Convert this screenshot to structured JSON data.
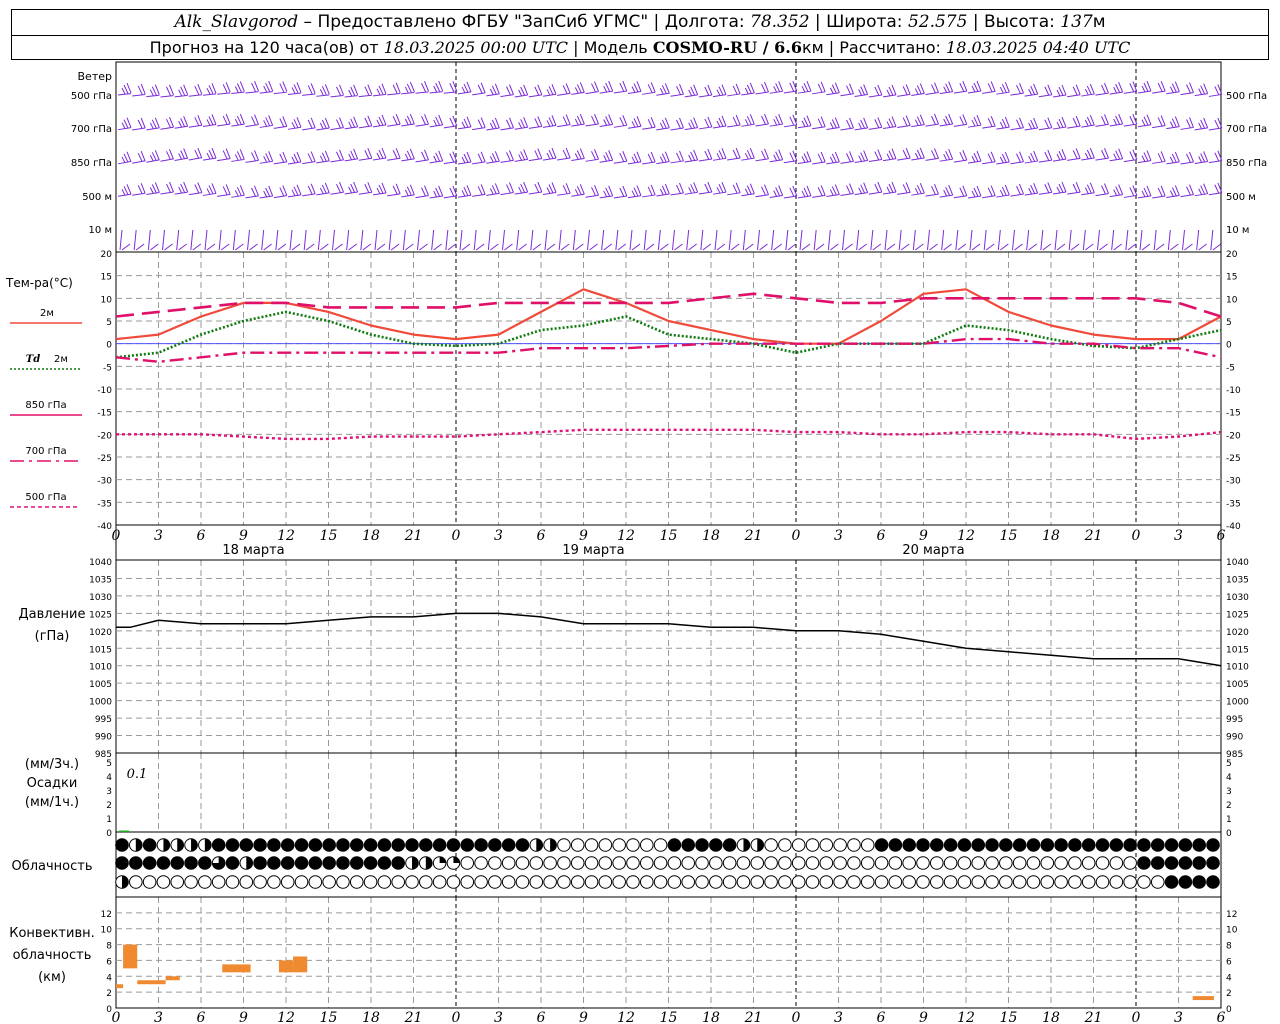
{
  "header": {
    "station": "Alk_Slavgorod",
    "dash": " – ",
    "provider": "Предоставлено ФГБУ \"ЗапСиб УГМС\"",
    "sep": " | ",
    "lon_label": "Долгота:",
    "lon_value": "78.352",
    "lat_label": "Широта:",
    "lat_value": "52.575",
    "alt_label": "Высота:",
    "alt_value": "137",
    "alt_unit": "м",
    "forecast_text": "Прогноз на 120 часа(ов) от",
    "forecast_start": "18.03.2025 00:00 UTC",
    "model_label": "Модель",
    "model_name": "COSMO-RU / 6.6",
    "model_unit": "км",
    "calc_label": "Рассчитано:",
    "calc_time": "18.03.2025 04:40 UTC"
  },
  "labels": {
    "wind_title": "Ветер",
    "wind_levels": [
      "500 гПа",
      "700 гПа",
      "850 гПа",
      "500 м",
      "10 м"
    ],
    "temp_title": "Тем-ра(°С)",
    "legend_2m": "2м",
    "legend_td": "Td",
    "legend_td_unit": "2м",
    "legend_850": "850 гПа",
    "legend_700": "700 гПа",
    "legend_500": "500 гПа",
    "pressure_title_1": "Давление",
    "pressure_title_2": "(гПа)",
    "precip_label_1": "(мм/3ч.)",
    "precip_label_2": "Осадки",
    "precip_label_3": "(мм/1ч.)",
    "precip_note": "0.1",
    "cloud_title": "Облачность",
    "conv_title_1": "Конвективн.",
    "conv_title_2": "облачность",
    "conv_title_3": "(км)",
    "days": [
      "18 марта",
      "19 марта",
      "20 марта"
    ]
  },
  "colors": {
    "wind": "#7b2ad8",
    "t2m": "#f04a3a",
    "td2m": "#107a10",
    "t850": "#e0106a",
    "t700": "#e0106a",
    "t500": "#e0107a",
    "pressure": "#000000",
    "precip": "#22aa22",
    "conv": "#f08a30",
    "zero_line": "#5555ff",
    "grid": "#9a9a9a"
  },
  "icons": {
    "cloud_cover": "cloud-cover-circle-icon"
  },
  "chart_data": [
    {
      "type": "wind-barbs",
      "levels": [
        "500 гПа",
        "700 гПа",
        "850 гПа",
        "500 м",
        "10 м"
      ],
      "x_hours": [
        0,
        120
      ],
      "x_tick_labels": [
        "0",
        "3",
        "6",
        "9",
        "12",
        "15",
        "18",
        "21",
        "0",
        "3",
        "6",
        "9",
        "12",
        "15",
        "18",
        "21",
        "0",
        "3",
        "6",
        "9",
        "12",
        "15",
        "18",
        "21",
        "0",
        "3",
        "6"
      ]
    },
    {
      "type": "line",
      "title": "Тем-ра(°С)",
      "x_unit": "hours",
      "x_tick_labels": [
        "0",
        "3",
        "6",
        "9",
        "12",
        "15",
        "18",
        "21",
        "0",
        "3",
        "6",
        "9",
        "12",
        "15",
        "18",
        "21",
        "0",
        "3",
        "6",
        "9",
        "12",
        "15",
        "18",
        "21",
        "0",
        "3",
        "6"
      ],
      "day_labels": [
        "18 марта",
        "19 марта",
        "20 марта"
      ],
      "ylim": [
        -40,
        20
      ],
      "yticks": [
        20,
        15,
        10,
        5,
        0,
        -5,
        -10,
        -15,
        -20,
        -25,
        -30,
        -35,
        -40
      ],
      "grid": true,
      "series": [
        {
          "name": "2м",
          "style": "solid",
          "x": [
            0,
            3,
            6,
            9,
            12,
            15,
            18,
            21,
            24,
            27,
            30,
            33,
            36,
            39,
            42,
            45,
            48,
            51,
            54,
            57,
            60,
            63,
            66,
            69,
            72,
            75,
            78
          ],
          "y": [
            1,
            2,
            6,
            9,
            9,
            7,
            4,
            2,
            1,
            2,
            7,
            12,
            9,
            5,
            3,
            1,
            0,
            0,
            5,
            11,
            12,
            7,
            4,
            2,
            1,
            1,
            6
          ]
        },
        {
          "name": "Td 2м",
          "style": "dotted",
          "x": [
            0,
            3,
            6,
            9,
            12,
            15,
            18,
            21,
            24,
            27,
            30,
            33,
            36,
            39,
            42,
            45,
            48,
            51,
            54,
            57,
            60,
            63,
            66,
            69,
            72,
            75,
            78
          ],
          "y": [
            -3,
            -2,
            2,
            5,
            7,
            5,
            2,
            0,
            -0.5,
            0,
            3,
            4,
            6,
            2,
            1,
            0,
            -2,
            0,
            0,
            0,
            4,
            3,
            1,
            -0.5,
            -1,
            1,
            3
          ]
        },
        {
          "name": "850 гПа",
          "style": "long-dash",
          "x": [
            0,
            3,
            6,
            9,
            12,
            15,
            18,
            21,
            24,
            27,
            30,
            33,
            36,
            39,
            42,
            45,
            48,
            51,
            54,
            57,
            60,
            63,
            66,
            69,
            72,
            75,
            78
          ],
          "y": [
            6,
            7,
            8,
            9,
            9,
            8,
            8,
            8,
            8,
            9,
            9,
            9,
            9,
            9,
            10,
            11,
            10,
            9,
            9,
            10,
            10,
            10,
            10,
            10,
            10,
            9,
            6
          ]
        },
        {
          "name": "700 гПа",
          "style": "dash-dot",
          "x": [
            0,
            3,
            6,
            9,
            12,
            15,
            18,
            21,
            24,
            27,
            30,
            33,
            36,
            39,
            42,
            45,
            48,
            51,
            54,
            57,
            60,
            63,
            66,
            69,
            72,
            75,
            78
          ],
          "y": [
            -3,
            -4,
            -3,
            -2,
            -2,
            -2,
            -2,
            -2,
            -2,
            -2,
            -1,
            -1,
            -1,
            -0.5,
            0,
            0,
            0,
            0,
            0,
            0,
            1,
            1,
            0,
            0,
            -1,
            -1,
            -3
          ]
        },
        {
          "name": "500 гПа",
          "style": "short-dash",
          "x": [
            0,
            3,
            6,
            9,
            12,
            15,
            18,
            21,
            24,
            27,
            30,
            33,
            36,
            39,
            42,
            45,
            48,
            51,
            54,
            57,
            60,
            63,
            66,
            69,
            72,
            75,
            78
          ],
          "y": [
            -20,
            -20,
            -20,
            -20.5,
            -21,
            -21,
            -20.5,
            -20.5,
            -20.5,
            -20,
            -19.5,
            -19,
            -19,
            -19,
            -19,
            -19,
            -19.5,
            -19.5,
            -20,
            -20,
            -19.5,
            -19.5,
            -20,
            -20,
            -21,
            -20.5,
            -19.5
          ]
        }
      ]
    },
    {
      "type": "line",
      "title": "Давление (гПа)",
      "ylim": [
        985,
        1040
      ],
      "yticks": [
        1040,
        1035,
        1030,
        1025,
        1020,
        1015,
        1010,
        1005,
        1000,
        995,
        990,
        985
      ],
      "grid": true,
      "series": [
        {
          "name": "Давление",
          "x": [
            0,
            1,
            3,
            6,
            9,
            12,
            15,
            18,
            21,
            24,
            27,
            30,
            33,
            36,
            39,
            42,
            45,
            48,
            51,
            54,
            57,
            60,
            63,
            66,
            69,
            72,
            75,
            78
          ],
          "y": [
            1021,
            1021,
            1023,
            1022,
            1022,
            1022,
            1023,
            1024,
            1024,
            1025,
            1025,
            1024,
            1022,
            1022,
            1022,
            1021,
            1021,
            1020,
            1020,
            1019,
            1017,
            1015,
            1014,
            1013,
            1012,
            1012,
            1012,
            1010
          ]
        }
      ]
    },
    {
      "type": "bar",
      "title": "Осадки",
      "ylim": [
        0,
        5
      ],
      "yticks": [
        5,
        4,
        3,
        2,
        1,
        0
      ],
      "annotations": [
        "0.1"
      ],
      "bars": [
        {
          "x": 0.5,
          "value": 0.1
        }
      ]
    },
    {
      "type": "table",
      "title": "Облачность",
      "rows": 3,
      "cells_per_row": 80,
      "cover": [
        "84844448888888888888888888888844000000008888844000000008888888888888888888888888",
        "88888886848888888888844220000000000000000000000000000000000000000000000000888888",
        "40000000000000000000000000000000000000000000000000000000000000000000000000008888"
      ]
    },
    {
      "type": "bar",
      "title": "Конвективн. облачность (км)",
      "ylim": [
        0,
        14
      ],
      "yticks": [
        12,
        10,
        8,
        6,
        4,
        2,
        0
      ],
      "bars": [
        {
          "x0": 0,
          "x1": 0.5,
          "lo": 2.5,
          "hi": 3
        },
        {
          "x0": 0.5,
          "x1": 1.5,
          "lo": 5,
          "hi": 8
        },
        {
          "x0": 1.5,
          "x1": 3.5,
          "lo": 3,
          "hi": 3.5
        },
        {
          "x0": 3.5,
          "x1": 4.5,
          "lo": 3.5,
          "hi": 4
        },
        {
          "x0": 7.5,
          "x1": 9.5,
          "lo": 4.5,
          "hi": 5.5
        },
        {
          "x0": 11.5,
          "x1": 12.5,
          "lo": 4.5,
          "hi": 6
        },
        {
          "x0": 12.5,
          "x1": 13.5,
          "lo": 4.5,
          "hi": 6.5
        },
        {
          "x0": 76,
          "x1": 77.5,
          "lo": 1,
          "hi": 1.5
        }
      ]
    }
  ]
}
